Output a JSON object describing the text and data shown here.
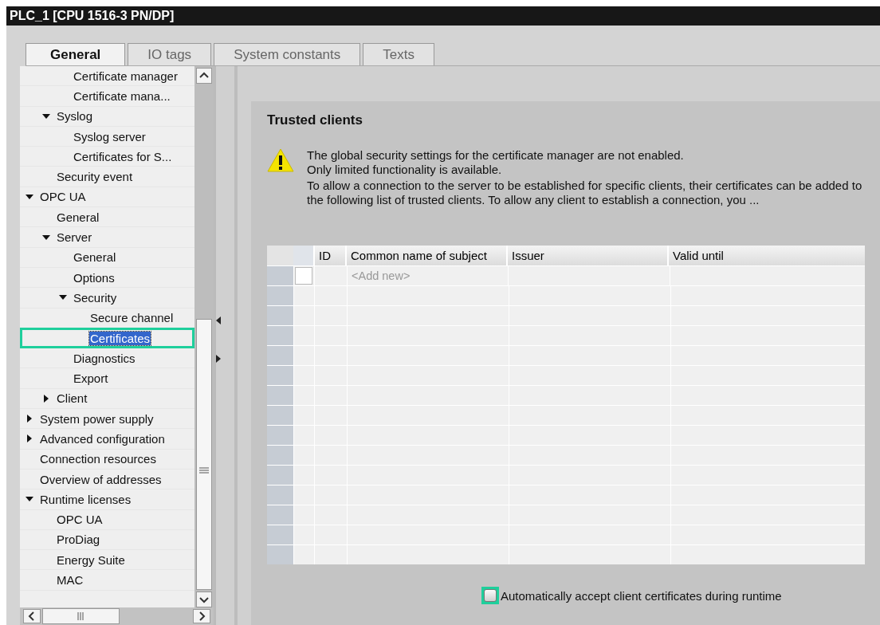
{
  "window": {
    "title": "PLC_1 [CPU 1516-3 PN/DP]"
  },
  "tabs": [
    {
      "label": "General",
      "selected": true
    },
    {
      "label": "IO tags",
      "selected": false
    },
    {
      "label": "System constants",
      "selected": false
    },
    {
      "label": "Texts",
      "selected": false
    }
  ],
  "tree": {
    "items": [
      {
        "children": [
          {
            "children": [
              {
                "label": "Certificate manager",
                "selected": false
              },
              {
                "label": "Certificate mana...",
                "selected": false
              }
            ]
          },
          {
            "label": "Syslog",
            "selected": false,
            "expanded": true,
            "children": [
              {
                "label": "Syslog server",
                "selected": false
              },
              {
                "label": "Certificates for S...",
                "selected": false
              }
            ]
          },
          {
            "label": "Security event",
            "selected": false
          }
        ]
      },
      {
        "label": "OPC UA",
        "selected": false,
        "expanded": true,
        "children": [
          {
            "label": "General",
            "selected": false
          },
          {
            "label": "Server",
            "selected": false,
            "expanded": true,
            "children": [
              {
                "label": "General",
                "selected": false
              },
              {
                "label": "Options",
                "selected": false
              },
              {
                "label": "Security",
                "selected": false,
                "expanded": true,
                "children": [
                  {
                    "label": "Secure channel",
                    "selected": false
                  },
                  {
                    "label": "Certificates",
                    "selected": true
                  }
                ]
              },
              {
                "label": "Diagnostics",
                "selected": false
              },
              {
                "label": "Export",
                "selected": false
              }
            ]
          },
          {
            "label": "Client",
            "selected": false,
            "expanded": false
          }
        ]
      },
      {
        "label": "System power supply",
        "selected": false,
        "expanded": false
      },
      {
        "label": "Advanced configuration",
        "selected": false,
        "expanded": false
      },
      {
        "label": "Connection resources",
        "selected": false
      },
      {
        "label": "Overview of addresses",
        "selected": false
      },
      {
        "label": "Runtime licenses",
        "selected": false,
        "expanded": true,
        "children": [
          {
            "label": "OPC UA",
            "selected": false
          },
          {
            "label": "ProDiag",
            "selected": false
          },
          {
            "label": "Energy Suite",
            "selected": false
          },
          {
            "label": "MAC",
            "selected": false
          }
        ]
      }
    ]
  },
  "section": {
    "title": "Trusted clients",
    "warning": [
      "The global security settings for the certificate manager are not enabled.",
      "Only limited functionality is available."
    ],
    "description": "To allow a connection to the server to be established for specific clients, their certificates can be added to the following list of trusted clients. To allow any client to establish a connection, you ...",
    "table": {
      "columns": [
        "ID",
        "Common name of subject",
        "Issuer",
        "Valid until"
      ],
      "new_row_placeholder": "<Add new>"
    },
    "auto_accept": {
      "label": "Automatically accept client certificates during runtime",
      "checked": false,
      "highlighted": true
    }
  }
}
